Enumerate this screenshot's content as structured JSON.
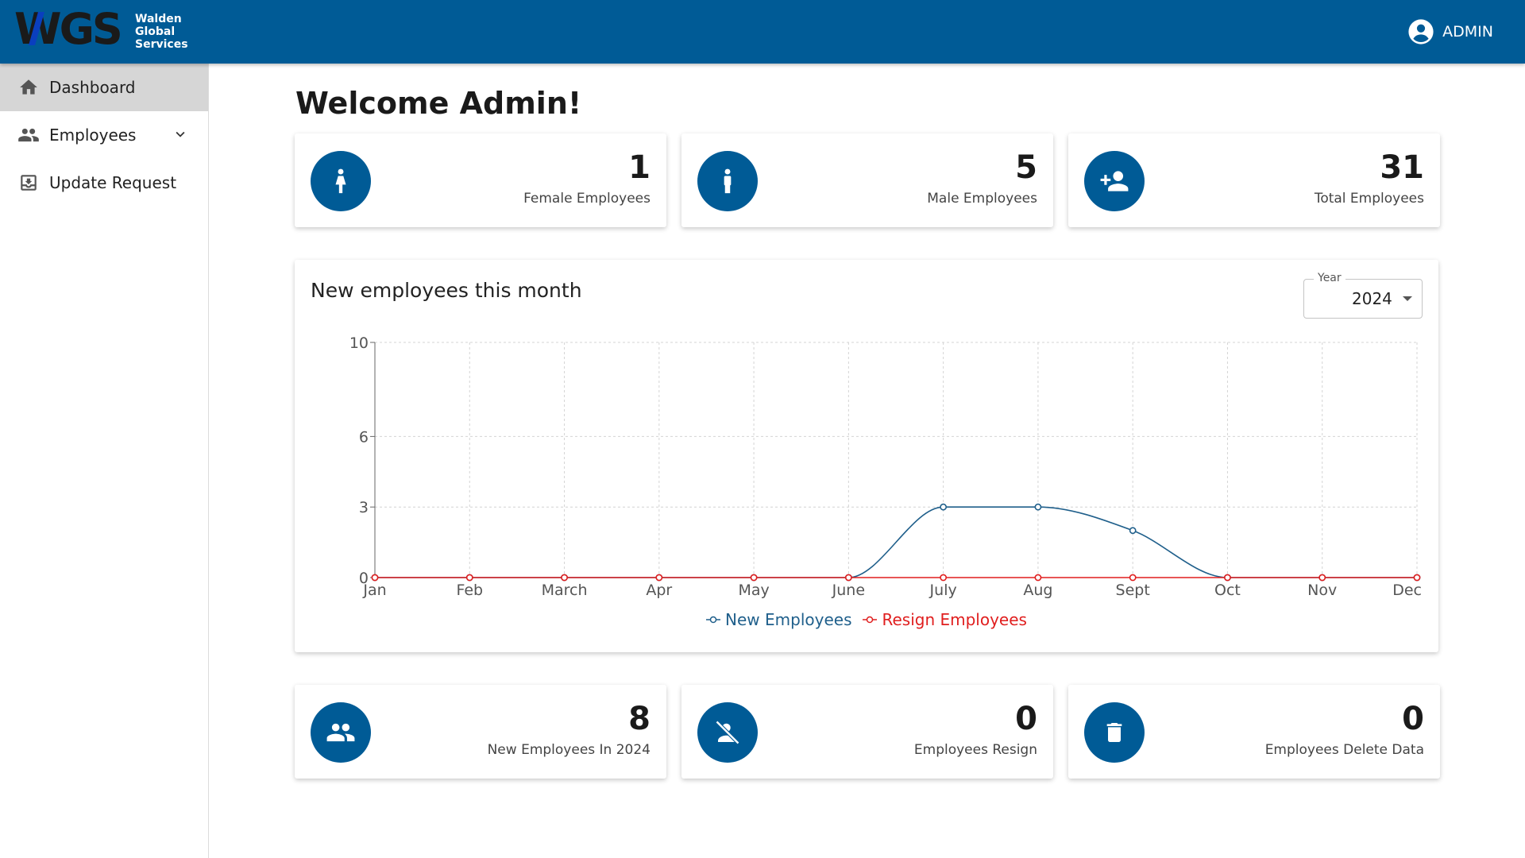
{
  "header": {
    "logo_text": "WGS",
    "logo_sub": [
      "Walden",
      "Global",
      "Services"
    ],
    "user_label": "ADMIN"
  },
  "sidebar": {
    "items": [
      {
        "label": "Dashboard",
        "icon": "home-icon",
        "active": true
      },
      {
        "label": "Employees",
        "icon": "people-icon",
        "has_submenu": true
      },
      {
        "label": "Update Request",
        "icon": "download-box-icon"
      }
    ]
  },
  "main": {
    "welcome": "Welcome Admin!",
    "top_stats": [
      {
        "value": "1",
        "label": "Female Employees",
        "icon": "female-icon"
      },
      {
        "value": "5",
        "label": "Male Employees",
        "icon": "male-icon"
      },
      {
        "value": "31",
        "label": "Total Employees",
        "icon": "person-add-icon"
      }
    ],
    "bottom_stats": [
      {
        "value": "8",
        "label": "New Employees In 2024",
        "icon": "group-icon"
      },
      {
        "value": "0",
        "label": "Employees Resign",
        "icon": "person-off-icon"
      },
      {
        "value": "0",
        "label": "Employees Delete Data",
        "icon": "trash-icon"
      }
    ],
    "chart_card": {
      "title": "New employees this month",
      "year_label": "Year",
      "year_value": "2024"
    }
  },
  "colors": {
    "brand": "#005b96",
    "new_series": "#1f5f8b",
    "resign_series": "#e01e1e"
  },
  "chart_data": {
    "type": "line",
    "categories": [
      "Jan",
      "Feb",
      "March",
      "Apr",
      "May",
      "June",
      "July",
      "Aug",
      "Sept",
      "Oct",
      "Nov",
      "Dec"
    ],
    "series": [
      {
        "name": "New Employees",
        "values": [
          0,
          0,
          0,
          0,
          0,
          0,
          3,
          3,
          2,
          0,
          0,
          0
        ]
      },
      {
        "name": "Resign Employees",
        "values": [
          0,
          0,
          0,
          0,
          0,
          0,
          0,
          0,
          0,
          0,
          0,
          0
        ]
      }
    ],
    "y_ticks": [
      0,
      3,
      6,
      10
    ],
    "ylim": [
      0,
      10
    ],
    "grid": true,
    "legend": "bottom-center"
  }
}
